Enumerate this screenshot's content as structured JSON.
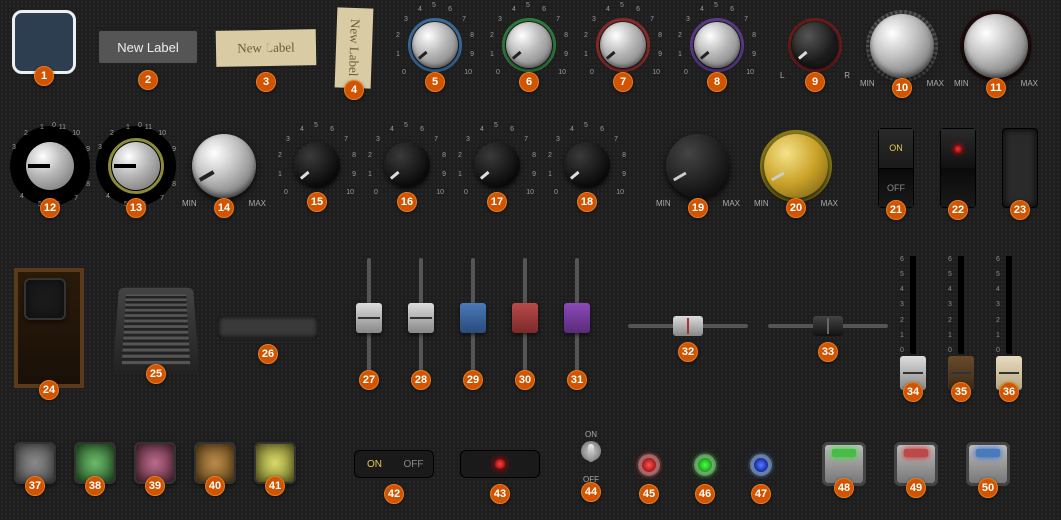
{
  "labels": {
    "new_label": "New Label",
    "new_label_tape": "New Label",
    "new_label_tape_v": "New Label"
  },
  "knob_ticks": [
    "0",
    "1",
    "2",
    "3",
    "4",
    "5",
    "6",
    "7",
    "8",
    "9",
    "10"
  ],
  "lr": {
    "L": "L",
    "R": "R"
  },
  "minmax": {
    "min": "MIN",
    "max": "MAX"
  },
  "rocker": {
    "on": "ON",
    "off": "OFF"
  },
  "toggle": {
    "on": "ON",
    "off": "OFF"
  },
  "onoff_h": {
    "on": "ON",
    "off": "OFF"
  },
  "fader_ticks": [
    "6",
    "5",
    "4",
    "3",
    "2",
    "1",
    "0"
  ],
  "badges": {
    "1": "1",
    "2": "2",
    "3": "3",
    "4": "4",
    "5": "5",
    "6": "6",
    "7": "7",
    "8": "8",
    "9": "9",
    "10": "10",
    "11": "11",
    "12": "12",
    "13": "13",
    "14": "14",
    "15": "15",
    "16": "16",
    "17": "17",
    "18": "18",
    "19": "19",
    "20": "20",
    "21": "21",
    "22": "22",
    "23": "23",
    "24": "24",
    "25": "25",
    "26": "26",
    "27": "27",
    "28": "28",
    "29": "29",
    "30": "30",
    "31": "31",
    "32": "32",
    "33": "33",
    "34": "34",
    "35": "35",
    "36": "36",
    "37": "37",
    "38": "38",
    "39": "39",
    "40": "40",
    "41": "41",
    "42": "42",
    "43": "43",
    "44": "44",
    "45": "45",
    "46": "46",
    "47": "47",
    "48": "48",
    "49": "49",
    "50": "50"
  },
  "row1_knobs": [
    {
      "id": 5,
      "ring": "blue"
    },
    {
      "id": 6,
      "ring": "green"
    },
    {
      "id": 7,
      "ring": "red"
    },
    {
      "id": 8,
      "ring": "purple"
    }
  ],
  "row2_black_knobs": [
    {
      "id": 15,
      "ring": "blue"
    },
    {
      "id": 16,
      "ring": "green"
    },
    {
      "id": 17,
      "ring": "red"
    },
    {
      "id": 18,
      "ring": "purple"
    }
  ],
  "vsliders": [
    {
      "id": 27,
      "thumb": "silver"
    },
    {
      "id": 28,
      "thumb": "silver"
    },
    {
      "id": 29,
      "thumb": "blue"
    },
    {
      "id": 30,
      "thumb": "red"
    },
    {
      "id": 31,
      "thumb": "purple"
    }
  ],
  "faders": [
    {
      "id": 34,
      "cap": "silver"
    },
    {
      "id": 35,
      "cap": "brown"
    },
    {
      "id": 36,
      "cap": "cream"
    }
  ],
  "pads": [
    {
      "id": 37,
      "c": "grey"
    },
    {
      "id": 38,
      "c": "green"
    },
    {
      "id": 39,
      "c": "pink"
    },
    {
      "id": 40,
      "c": "orange"
    },
    {
      "id": 41,
      "c": "yellow"
    }
  ],
  "leds": [
    {
      "id": 45,
      "c": "red"
    },
    {
      "id": 46,
      "c": "green"
    },
    {
      "id": 47,
      "c": "blue"
    }
  ],
  "sq_btns": [
    {
      "id": 48,
      "c": "green"
    },
    {
      "id": 49,
      "c": "red"
    },
    {
      "id": 50,
      "c": "blue"
    }
  ]
}
